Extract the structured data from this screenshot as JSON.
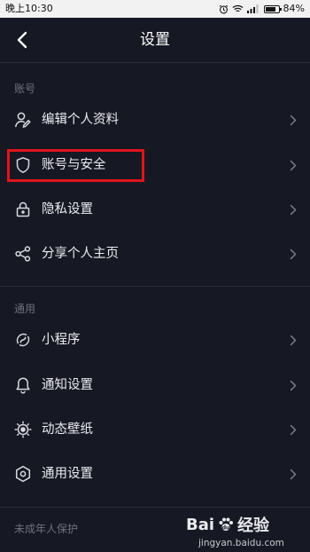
{
  "statusbar": {
    "time": "晚上10:30",
    "icons": [
      "alarm-icon",
      "wifi-icon",
      "signal-icon",
      "battery-icon"
    ],
    "battery_percent": "84%",
    "battery_level": 0.84
  },
  "header": {
    "title": "设置",
    "back_icon": "back-arrow-icon"
  },
  "sections": [
    {
      "header": "账号",
      "items": [
        {
          "label": "编辑个人资料",
          "icon": "person-edit-icon"
        },
        {
          "label": "账号与安全",
          "icon": "shield-icon"
        },
        {
          "label": "隐私设置",
          "icon": "lock-icon"
        },
        {
          "label": "分享个人主页",
          "icon": "share-icon"
        }
      ]
    },
    {
      "header": "通用",
      "items": [
        {
          "label": "小程序",
          "icon": "mini-program-icon"
        },
        {
          "label": "通知设置",
          "icon": "bell-icon"
        },
        {
          "label": "动态壁纸",
          "icon": "wallpaper-icon"
        },
        {
          "label": "通用设置",
          "icon": "gear-hexagon-icon"
        }
      ]
    },
    {
      "header": "未成年人保护",
      "items": []
    }
  ],
  "highlight_color": "#e0141c",
  "watermark": {
    "brand": "Bai",
    "brand_suffix": "经验",
    "url": "jingyan.baidu.com"
  }
}
